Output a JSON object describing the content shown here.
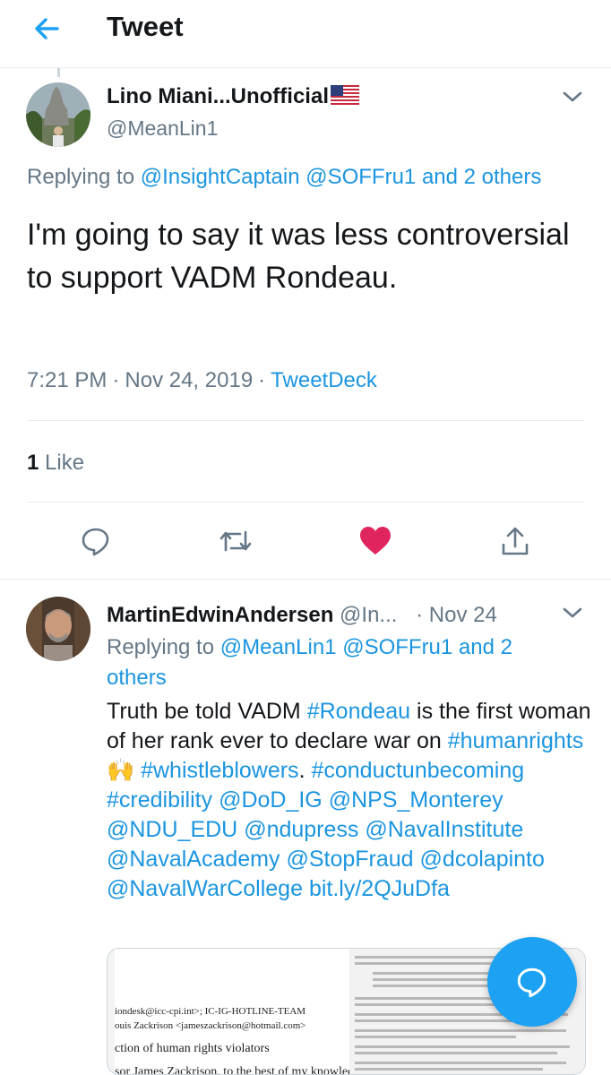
{
  "header": {
    "title": "Tweet"
  },
  "tweet": {
    "display_name": "Lino Miani...Unofficial",
    "handle": "@MeanLin1",
    "replying_prefix": "Replying to",
    "replying_to": [
      "@InsightCaptain",
      "@SOFFru1"
    ],
    "replying_others": "and 2 others",
    "text": "I'm going to say it was less controversial to support VADM Rondeau.",
    "time": "7:21 PM",
    "date": "Nov 24, 2019",
    "source": "TweetDeck",
    "like_count": "1",
    "like_label": "Like",
    "liked": true
  },
  "reply": {
    "display_name": "MartinEdwinAndersen",
    "handle": "@In...",
    "date": "Nov 24",
    "replying_prefix": "Replying to",
    "replying_to": [
      "@MeanLin1",
      "@SOFFru1"
    ],
    "replying_others": "and 2 others",
    "text_parts": {
      "t1": "Truth be told VADM ",
      "tag_rondeau": "#Rondeau",
      "t2": " is the first woman of her rank ever to declare war on ",
      "tag_humanrights": "#humanrights",
      "emoji": "🙌",
      "tag_whistleblowers": "#whistleblowers",
      "t3": ".",
      "tag_conduct": "#conductunbecoming",
      "tag_credibility": "#credibility",
      "m_dodig": "@DoD_IG",
      "m_nps": "@NPS_Monterey",
      "m_ndu": "@NDU_EDU",
      "m_ndupress": "@ndupress",
      "m_navalinstitute": "@NavalInstitute",
      "m_navalacademy": "@NavalAcademy",
      "m_stopfraud": "@StopFraud",
      "m_dcolapinto": "@dcolapinto",
      "m_nwc": "@NavalWarCollege",
      "url": "bit.ly/2QJuDfa"
    },
    "media_lines": [
      "iondesk@icc-cpi.int>; IC-IG-HOTLINE-TEAM",
      "ouis Zackrison <jameszackrison@hotmail.com>",
      "ction of human rights violators",
      "sor James Zackrison, to the best of my knowledg"
    ]
  },
  "colors": {
    "link": "#1b95e0",
    "secondary": "#657786",
    "like": "#e0245e",
    "fab": "#1da1f2"
  },
  "icons": {
    "back": "arrow-left-icon",
    "chevron": "chevron-down-icon",
    "reply": "reply-icon",
    "retweet": "retweet-icon",
    "like": "heart-icon",
    "share": "share-icon",
    "compose": "compose-reply-icon",
    "flag": "us-flag-icon"
  }
}
